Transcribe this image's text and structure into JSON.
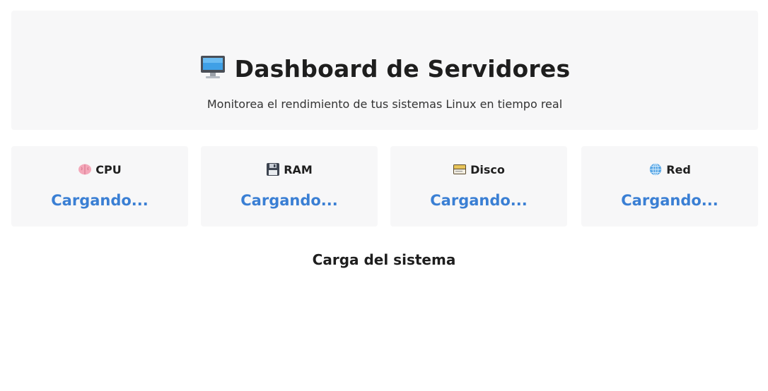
{
  "header": {
    "title": "Dashboard de Servidores",
    "subtitle": "Monitorea el rendimiento de tus sistemas Linux en tiempo real",
    "icon": "desktop-computer-icon"
  },
  "cards": [
    {
      "label": "CPU",
      "value": "Cargando...",
      "icon": "brain-icon"
    },
    {
      "label": "RAM",
      "value": "Cargando...",
      "icon": "floppy-disk-icon"
    },
    {
      "label": "Disco",
      "value": "Cargando...",
      "icon": "card-index-icon"
    },
    {
      "label": "Red",
      "value": "Cargando...",
      "icon": "globe-icon"
    }
  ],
  "section": {
    "title": "Carga del sistema"
  },
  "colors": {
    "accent": "#3a7fd4",
    "panel_bg": "#f7f7f8",
    "text": "#1f1f1f"
  }
}
